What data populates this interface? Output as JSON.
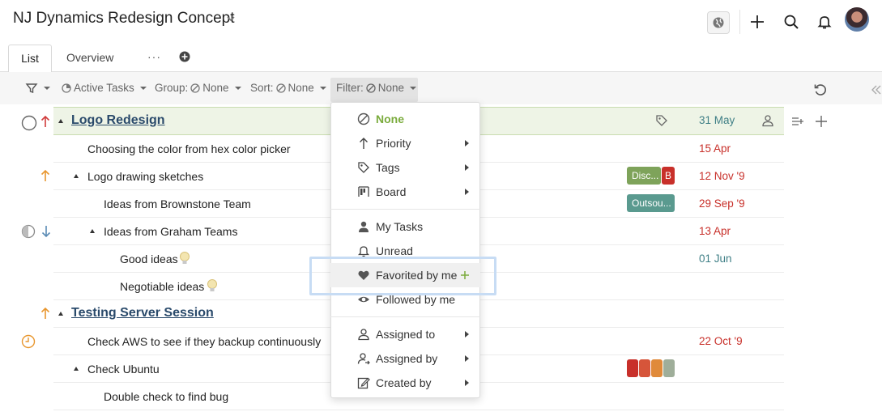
{
  "header": {
    "project_title": "NJ Dynamics Redesign Concept"
  },
  "tabs": [
    {
      "label": "List",
      "active": true
    },
    {
      "label": "Overview",
      "active": false
    }
  ],
  "tabs_more": "···",
  "toolbar": {
    "active_tasks": "Active Tasks",
    "group_label": "Group:",
    "group_value": "None",
    "sort_label": "Sort:",
    "sort_value": "None",
    "filter_label": "Filter:",
    "filter_value": "None"
  },
  "groups": [
    {
      "title": "Logo Redesign",
      "date": "31 May"
    },
    {
      "title": "Testing Server Session"
    }
  ],
  "tasks": [
    {
      "text": "Choosing the color from hex color picker",
      "date": "15 Apr"
    },
    {
      "text": "Logo drawing sketches",
      "tags": [
        "Disc...",
        "B"
      ],
      "date": "12 Nov '9"
    },
    {
      "text": "Ideas from Brownstone Team",
      "tags": [
        "Outsou..."
      ],
      "date": "29 Sep '9"
    },
    {
      "text": "Ideas from Graham Teams",
      "date": "13 Apr"
    },
    {
      "text": "Good ideas",
      "date": "01 Jun"
    },
    {
      "text": "Negotiable ideas"
    },
    {
      "text": "Check AWS to see if they backup continuously",
      "date": "22 Oct '9"
    },
    {
      "text": "Check Ubuntu"
    },
    {
      "text": "Double check to find bug"
    }
  ],
  "filter_menu": {
    "items": [
      {
        "label": "None",
        "icon": "none-icon",
        "selected": true
      },
      {
        "label": "Priority",
        "icon": "arrow-up-icon",
        "submenu": true
      },
      {
        "label": "Tags",
        "icon": "tag-icon",
        "submenu": true
      },
      {
        "label": "Board",
        "icon": "board-icon",
        "submenu": true
      },
      {
        "label": "My Tasks",
        "icon": "person-icon"
      },
      {
        "label": "Unread",
        "icon": "bell-icon"
      },
      {
        "label": "Favorited by me",
        "icon": "heart-icon",
        "highlighted": true
      },
      {
        "label": "Followed by me",
        "icon": "eye-icon"
      },
      {
        "label": "Assigned to",
        "icon": "assigned-to-icon",
        "submenu": true
      },
      {
        "label": "Assigned by",
        "icon": "assigned-by-icon",
        "submenu": true
      },
      {
        "label": "Created by",
        "icon": "created-by-icon",
        "submenu": true
      }
    ]
  },
  "colors": {
    "accent_green": "#7aab3c",
    "group_link": "#2a4a6b",
    "date_red": "#c8302a",
    "date_teal": "#3f7f86",
    "tag_green": "#7ea35a",
    "tag_teal": "#5a9a8f",
    "tag_red": "#c8302a",
    "priority_orange": "#e8962e",
    "priority_red": "#d03b3b",
    "priority_blue": "#5a8bb5"
  }
}
